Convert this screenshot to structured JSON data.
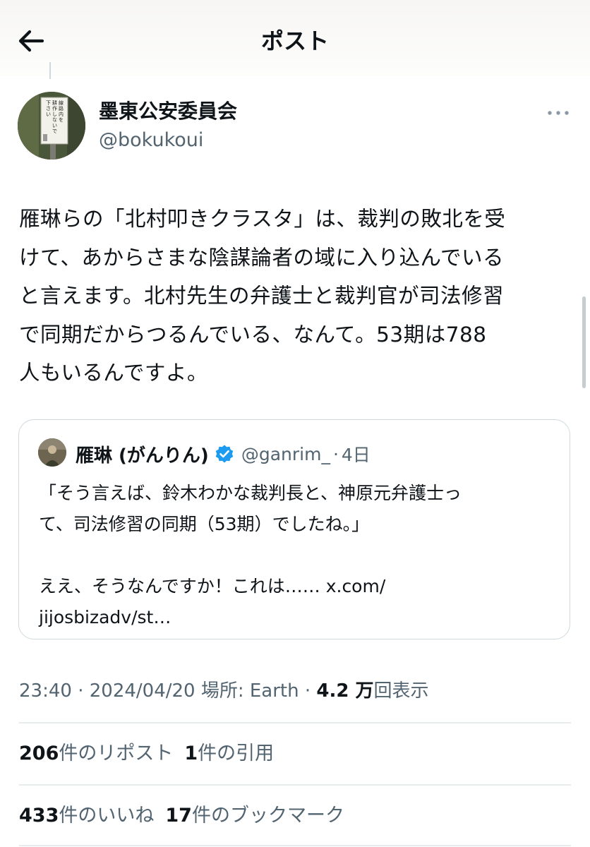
{
  "header": {
    "title": "ポスト"
  },
  "post": {
    "author": {
      "display_name": "墨東公安委員会",
      "handle": "@bokukoui"
    },
    "avatar_sign_text": "線路内を\n耕作しないで\n下さい\n名古屋鉄道",
    "text": "雁琳らの「北村叩きクラスタ」は、裁判の敗北を受\nけて、あからさまな陰謀論者の域に入り込んでいる\nと言えます。北村先生の弁護士と裁判官が司法修習\nで同期だからつるんでいる、なんて。53期は788\n人もいるんですよ。"
  },
  "quote": {
    "display_name": "雁琳 (がんりん)",
    "handle": "@ganrim_",
    "separator": "·",
    "time": "4日",
    "text": "「そう言えば、鈴木わかな裁判長と、神原元弁護士っ\nて、司法修習の同期（53期）でしたね。」\n\nええ、そうなんですか！これは…… x.com/\njijosbizadv/st…"
  },
  "meta": {
    "time": "23:40",
    "dot1": " · ",
    "date": "2024/04/20",
    "location": " 場所: Earth",
    "dot2": " · ",
    "views_count": "4.2 万",
    "views_label": "回表示"
  },
  "stats": {
    "reposts_count": "206",
    "reposts_label": "件のリポスト",
    "quotes_count": "1",
    "quotes_label": "件の引用",
    "likes_count": "433",
    "likes_label": "件のいいね",
    "bookmarks_count": "17",
    "bookmarks_label": "件のブックマーク"
  },
  "colors": {
    "text": "#0f1419",
    "secondary": "#536471",
    "verified": "#1d9bf0",
    "border": "#cfd9de"
  }
}
